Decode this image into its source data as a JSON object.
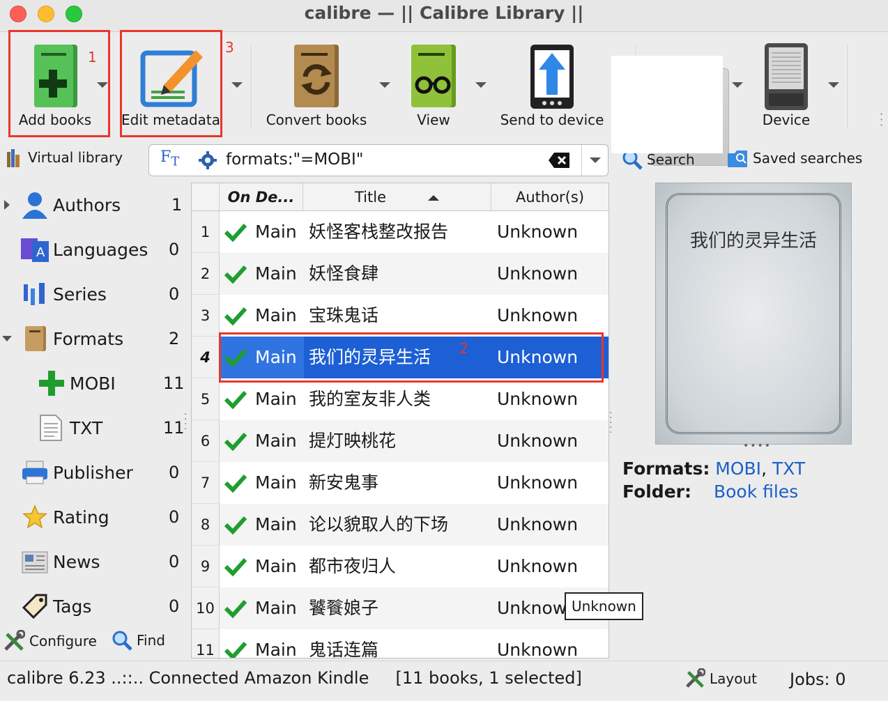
{
  "window": {
    "title": "calibre — || Calibre Library ||"
  },
  "toolbar": {
    "add_books": "Add books",
    "edit_metadata": "Edit metadata",
    "convert_books": "Convert books",
    "view": "View",
    "send_to_device": "Send to device",
    "device": "Device",
    "annotations": {
      "add_books_num": "1",
      "edit_metadata_num": "3",
      "selected_row_num": "2"
    }
  },
  "searchbar": {
    "virtual_library": "Virtual library",
    "ft_glyph": "F",
    "ft_glyph_sub": "T",
    "query": "formats:\"=MOBI\"",
    "search": "Search",
    "saved_searches": "Saved searches"
  },
  "tag_browser": {
    "items": [
      {
        "label": "Authors",
        "count": "1",
        "icon": "person-icon"
      },
      {
        "label": "Languages",
        "count": "0",
        "icon": "languages-icon"
      },
      {
        "label": "Series",
        "count": "0",
        "icon": "series-icon"
      },
      {
        "label": "Formats",
        "count": "2",
        "icon": "book-icon"
      },
      {
        "label": "MOBI",
        "count": "11",
        "icon": "plus-icon"
      },
      {
        "label": "TXT",
        "count": "11",
        "icon": "document-icon"
      },
      {
        "label": "Publisher",
        "count": "0",
        "icon": "printer-icon"
      },
      {
        "label": "Rating",
        "count": "0",
        "icon": "star-icon"
      },
      {
        "label": "News",
        "count": "0",
        "icon": "news-icon"
      },
      {
        "label": "Tags",
        "count": "0",
        "icon": "tag-icon"
      }
    ],
    "configure": "Configure",
    "find": "Find"
  },
  "book_list": {
    "columns": [
      "On De...",
      "Title",
      "Author(s)"
    ],
    "rows": [
      {
        "n": "1",
        "lib": "Main",
        "title": "妖怪客栈整改报告",
        "author": "Unknown"
      },
      {
        "n": "2",
        "lib": "Main",
        "title": "妖怪食肆",
        "author": "Unknown"
      },
      {
        "n": "3",
        "lib": "Main",
        "title": "宝珠鬼话",
        "author": "Unknown"
      },
      {
        "n": "4",
        "lib": "Main",
        "title": "我们的灵异生活",
        "author": "Unknown"
      },
      {
        "n": "5",
        "lib": "Main",
        "title": "我的室友非人类",
        "author": "Unknown"
      },
      {
        "n": "6",
        "lib": "Main",
        "title": "提灯映桃花",
        "author": "Unknown"
      },
      {
        "n": "7",
        "lib": "Main",
        "title": "新安鬼事",
        "author": "Unknown"
      },
      {
        "n": "8",
        "lib": "Main",
        "title": "论以貌取人的下场",
        "author": "Unknown"
      },
      {
        "n": "9",
        "lib": "Main",
        "title": "都市夜归人",
        "author": "Unknown"
      },
      {
        "n": "10",
        "lib": "Main",
        "title": "饕餮娘子",
        "author": "Unknow"
      },
      {
        "n": "11",
        "lib": "Main",
        "title": "鬼话连篇",
        "author": "Unknown"
      }
    ],
    "selected_index": 3,
    "tooltip": "Unknown"
  },
  "details": {
    "cover_title": "我们的灵异生活",
    "formats_label": "Formats:",
    "format_1": "MOBI",
    "format_sep": ",",
    "format_2": "TXT",
    "folder_label": "Folder:",
    "folder_link": "Book files"
  },
  "statusbar": {
    "left": "calibre 6.23 ..::.. Connected Amazon Kindle     [11 books, 1 selected]",
    "layout": "Layout",
    "jobs": "Jobs: 0"
  },
  "colors": {
    "accent": "#1d5fd4",
    "annotation_red": "#e8362a",
    "check_green": "#1e9e2e",
    "link_blue": "#1b5fc8"
  }
}
